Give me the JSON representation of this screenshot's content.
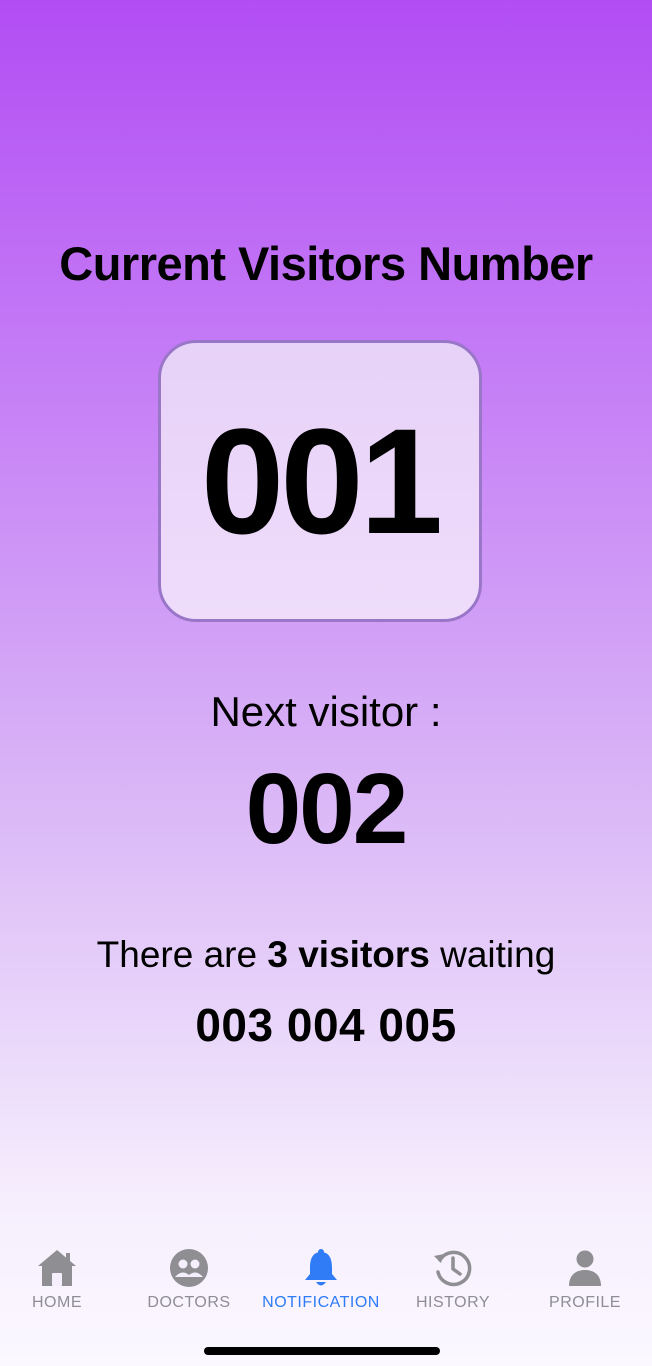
{
  "header": {
    "title": "Current Visitors Number"
  },
  "current": {
    "number": "001"
  },
  "next": {
    "label": "Next visitor :",
    "number": "002"
  },
  "waiting": {
    "prefix": "There are ",
    "count_text": "3 visitors",
    "suffix": " waiting",
    "numbers": "003 004 005"
  },
  "tabbar": {
    "active_color": "#2f7cf6",
    "inactive_color": "#8e8e93",
    "items": [
      {
        "label": "HOME",
        "icon": "home-icon"
      },
      {
        "label": "DOCTORS",
        "icon": "doctors-icon"
      },
      {
        "label": "NOTIFICATION",
        "icon": "bell-icon",
        "active": true
      },
      {
        "label": "HISTORY",
        "icon": "history-icon"
      },
      {
        "label": "PROFILE",
        "icon": "person-icon"
      }
    ]
  }
}
